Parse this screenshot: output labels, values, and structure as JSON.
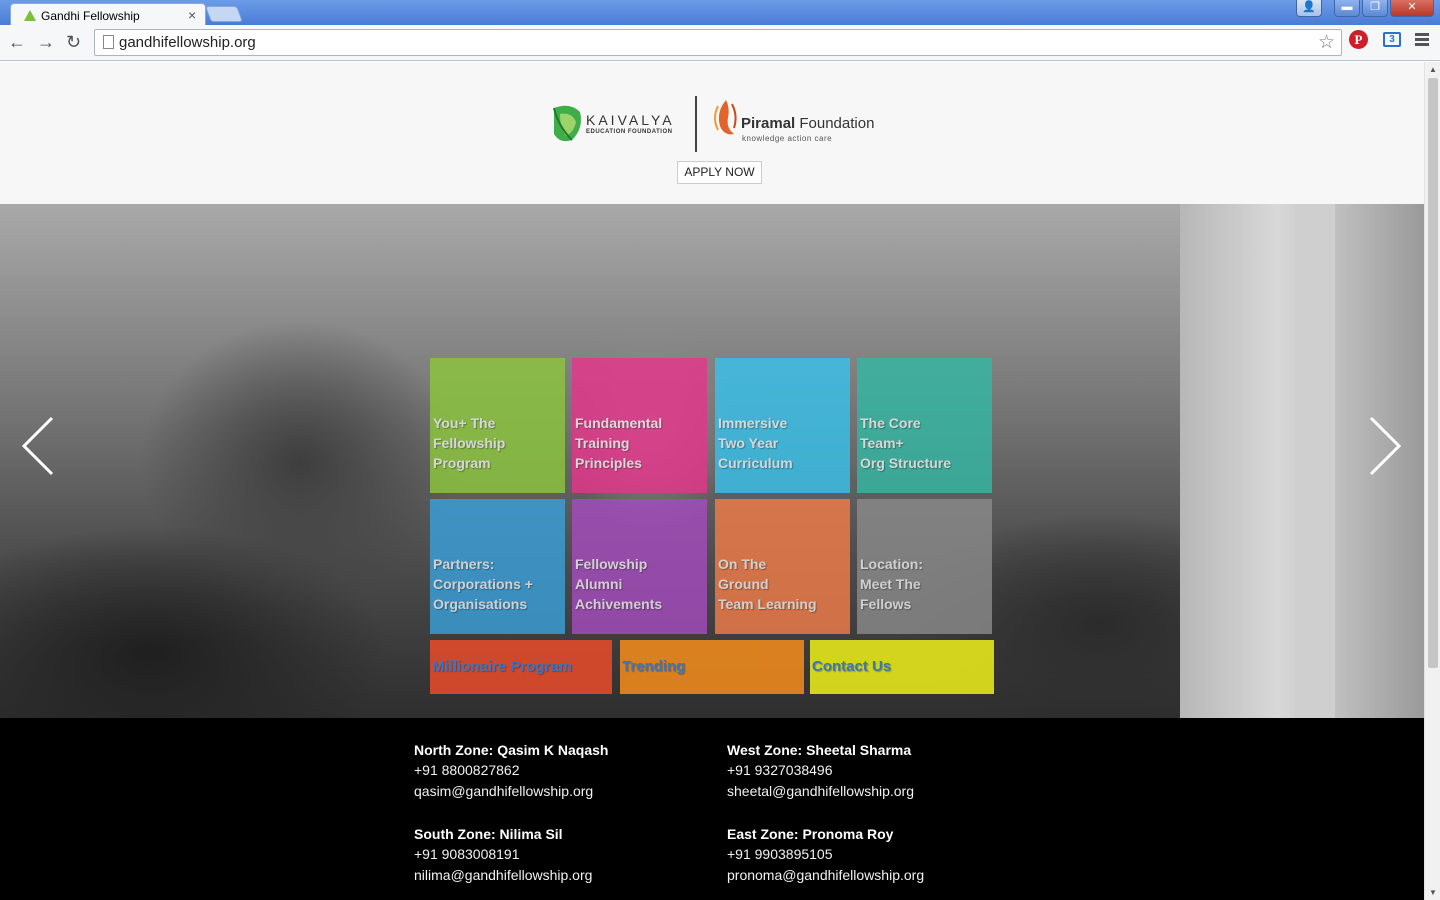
{
  "browser": {
    "tab_title": "Gandhi Fellowship",
    "tab_close": "×",
    "url": "gandhifellowship.org",
    "window_buttons": [
      "👤",
      "▬",
      "❐",
      "✕"
    ],
    "back_icon": "←",
    "forward_icon": "→",
    "reload_icon": "↻",
    "star_icon": "☆",
    "pinterest_label": "P",
    "ext_label": "3"
  },
  "header": {
    "kaivalya_name": "KAIVALYA",
    "kaivalya_sub": "EDUCATION FOUNDATION",
    "piramal_brand": "Piramal",
    "piramal_rest": " Foundation",
    "piramal_tagline": "knowledge action care",
    "apply_label": "APPLY NOW"
  },
  "hero": {
    "prev_icon": "chevron-left-icon",
    "next_icon": "chevron-right-icon",
    "tiles": [
      {
        "label": "You+ The\nFellowship\nProgram",
        "color": "#8cc63e"
      },
      {
        "label": "Fundamental\nTraining\nPrinciples",
        "color": "#e6358b"
      },
      {
        "label": "Immersive\nTwo Year\nCurriculum",
        "color": "#39c1ea"
      },
      {
        "label": "The Core\nTeam+\nOrg Structure",
        "color": "#34b7a2"
      },
      {
        "label": "Partners:\nCorporations +\nOrganisations",
        "color": "#3a9fd8"
      },
      {
        "label": "Fellowship\nAlumni\nAchivements",
        "color": "#a54bbd"
      },
      {
        "label": "On The\nGround\nTeam Learning",
        "color": "#f07c49"
      },
      {
        "label": "Location:\nMeet The\nFellows",
        "color": "#8a8a8a"
      }
    ],
    "bars": [
      {
        "label": "Millionaire Program",
        "color": "#e54b2a",
        "text_color": "#3a7fd5"
      },
      {
        "label": "Trending",
        "color": "#f08a1c",
        "text_color": "#3a7fd5"
      },
      {
        "label": "Contact Us",
        "color": "#e8ea1a",
        "text_color": "#3a7fd5"
      }
    ]
  },
  "footer": {
    "zones": [
      {
        "name": "North Zone: Qasim K Naqash",
        "phone": "+91 8800827862",
        "email": "qasim@gandhifellowship.org"
      },
      {
        "name": "West Zone: Sheetal Sharma",
        "phone": "+91 9327038496",
        "email": "sheetal@gandhifellowship.org"
      },
      {
        "name": "South Zone: Nilima Sil",
        "phone": "+91 9083008191",
        "email": "nilima@gandhifellowship.org"
      },
      {
        "name": "East Zone: Pronoma Roy",
        "phone": "+91 9903895105",
        "email": "pronoma@gandhifellowship.org"
      }
    ]
  }
}
